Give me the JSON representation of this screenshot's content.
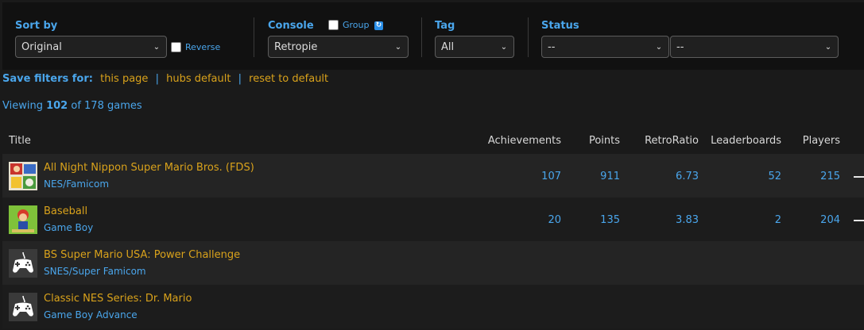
{
  "filters": {
    "sort_by": {
      "label": "Sort by",
      "value": "Original",
      "reverse_label": "Reverse"
    },
    "console": {
      "label": "Console",
      "group_label": "Group",
      "sync_icon": "sync-icon",
      "value": "Retropie"
    },
    "tag": {
      "label": "Tag",
      "value": "All"
    },
    "status": {
      "label": "Status",
      "value1": "--",
      "value2": "--"
    }
  },
  "save_filters": {
    "label": "Save filters for:",
    "links": [
      "this page",
      "hubs default",
      "reset to default"
    ],
    "separator": "|"
  },
  "viewing": {
    "prefix": "Viewing",
    "shown": "102",
    "middle": "of 178 games"
  },
  "table": {
    "headers": {
      "title": "Title",
      "achievements": "Achievements",
      "points": "Points",
      "retroratio": "RetroRatio",
      "leaderboards": "Leaderboards",
      "players": "Players"
    },
    "rows": [
      {
        "title": "All Night Nippon Super Mario Bros. (FDS)",
        "console": "NES/Famicom",
        "icon": "game-boxart-icon",
        "achievements": "107",
        "points": "911",
        "retroratio": "6.73",
        "leaderboards": "52",
        "players": "215"
      },
      {
        "title": "Baseball",
        "console": "Game Boy",
        "icon": "game-boxart-icon",
        "achievements": "20",
        "points": "135",
        "retroratio": "3.83",
        "leaderboards": "2",
        "players": "204"
      },
      {
        "title": "BS Super Mario USA: Power Challenge",
        "console": "SNES/Super Famicom",
        "icon": "controller-icon",
        "achievements": "",
        "points": "",
        "retroratio": "",
        "leaderboards": "",
        "players": ""
      },
      {
        "title": "Classic NES Series: Dr. Mario",
        "console": "Game Boy Advance",
        "icon": "controller-icon",
        "achievements": "",
        "points": "",
        "retroratio": "",
        "leaderboards": "",
        "players": ""
      }
    ]
  },
  "colors": {
    "accent_blue": "#4aa6ec",
    "link_gold": "#d9a21b",
    "panel_bg": "#111111",
    "page_bg": "#1a1a1a"
  }
}
